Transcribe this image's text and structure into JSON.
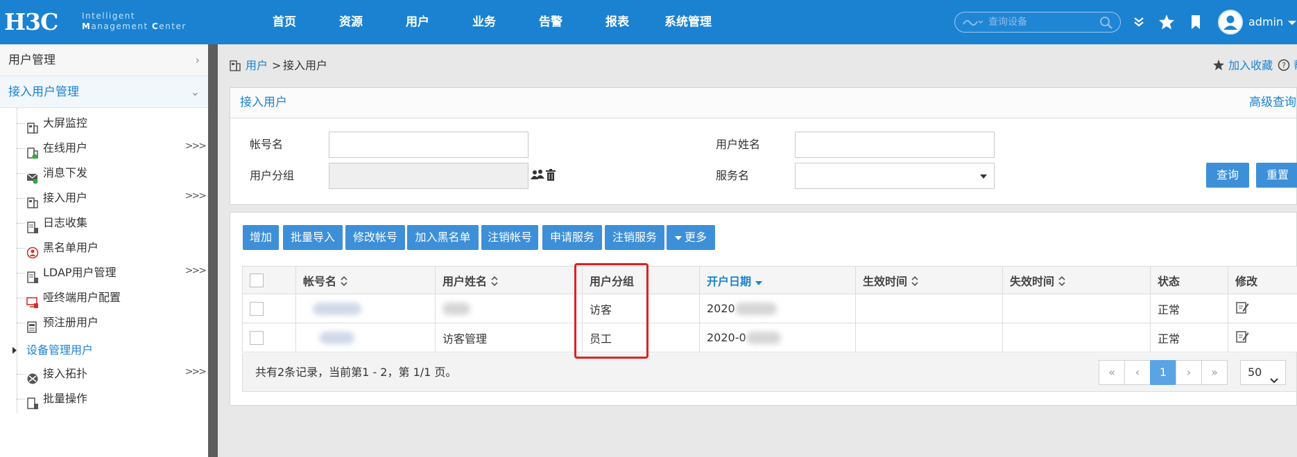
{
  "header": {
    "logo_main": "H3C",
    "logo_line1": "Intelligent",
    "logo_line2a": "M",
    "logo_line2b": "anagement ",
    "logo_line2c": "C",
    "logo_line2d": "enter",
    "nav": [
      "首页",
      "资源",
      "用户",
      "业务",
      "告警",
      "报表",
      "系统管理"
    ],
    "search_placeholder": "查询设备",
    "username": "admin"
  },
  "sidebar": {
    "section1": "用户管理",
    "section2": "接入用户管理",
    "items": [
      {
        "label": "大屏监控",
        "icon": "screen-monitor-icon",
        "more": ""
      },
      {
        "label": "在线用户",
        "icon": "online-user-icon",
        "more": ">>>"
      },
      {
        "label": "消息下发",
        "icon": "message-icon",
        "more": ""
      },
      {
        "label": "接入用户",
        "icon": "access-user-icon",
        "more": ">>>"
      },
      {
        "label": "日志收集",
        "icon": "log-collect-icon",
        "more": ""
      },
      {
        "label": "黑名单用户",
        "icon": "blacklist-user-icon",
        "more": ""
      },
      {
        "label": "LDAP用户管理",
        "icon": "ldap-icon",
        "more": ">>>"
      },
      {
        "label": "哑终端用户配置",
        "icon": "dumb-terminal-icon",
        "more": ""
      },
      {
        "label": "预注册用户",
        "icon": "preregister-icon",
        "more": ""
      }
    ],
    "group": "设备管理用户",
    "items2": [
      {
        "label": "接入拓扑",
        "icon": "topology-icon",
        "more": ">>>"
      },
      {
        "label": "批量操作",
        "icon": "batch-icon",
        "more": ""
      }
    ]
  },
  "breadcrumb": {
    "parent": "用户",
    "separator": ">",
    "current": "接入用户",
    "favorite": "加入收藏",
    "help": "帮助"
  },
  "query_panel": {
    "title": "接入用户",
    "advanced": "高级查询",
    "account_label": "帐号名",
    "account_value": "",
    "realname_label": "用户姓名",
    "realname_value": "",
    "group_label": "用户分组",
    "group_value": "",
    "service_label": "服务名",
    "service_value": "",
    "query_btn": "查询",
    "reset_btn": "重置"
  },
  "toolbar": [
    "增加",
    "批量导入",
    "修改帐号",
    "加入黑名单",
    "注销帐号",
    "申请服务",
    "注销服务",
    "更多"
  ],
  "table": {
    "columns": [
      "帐号名",
      "用户姓名",
      "用户分组",
      "开户日期",
      "生效时间",
      "失效时间",
      "状态",
      "修改"
    ],
    "rows": [
      {
        "account": "",
        "realname": "",
        "group": "访客",
        "date": "2020",
        "start": "",
        "end": "",
        "status": "正常"
      },
      {
        "account": "",
        "realname": "访客管理",
        "group": "员工",
        "date": "2020-0",
        "start": "",
        "end": "",
        "status": "正常"
      }
    ],
    "summary": "共有2条记录，当前第1 - 2，第 1/1 页。",
    "pager": [
      "«",
      "‹",
      "1",
      "›",
      "»"
    ],
    "current_page": "1",
    "page_size": "50"
  },
  "colors": {
    "brand_blue": "#1b82d2",
    "button_blue": "#3d8fd8",
    "highlight_red": "#e02020"
  }
}
